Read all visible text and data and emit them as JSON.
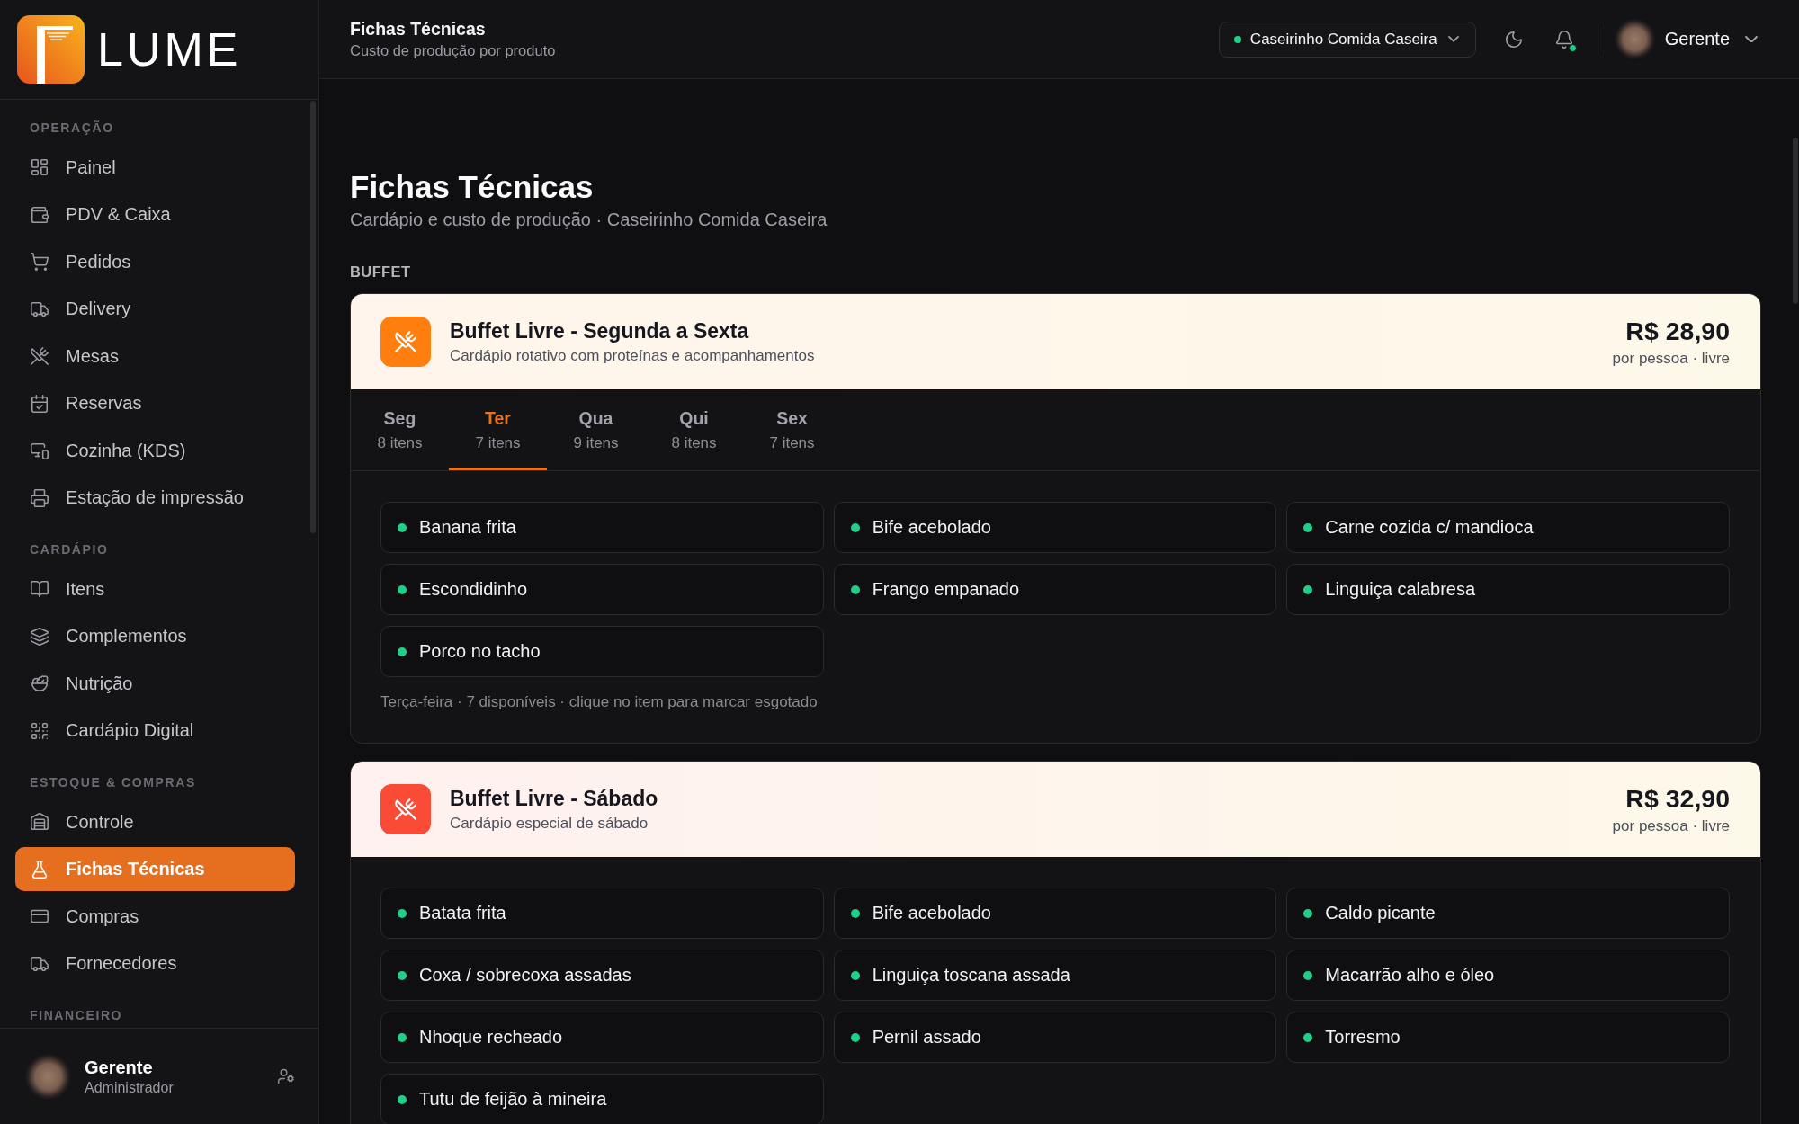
{
  "sidebar": {
    "logo": {
      "wordmark": "LUME"
    },
    "sections": [
      {
        "label": "OPERAÇÃO",
        "items": [
          {
            "label": "Painel",
            "selected": false
          },
          {
            "label": "PDV & Caixa",
            "selected": false
          },
          {
            "label": "Pedidos",
            "selected": false
          },
          {
            "label": "Delivery",
            "selected": false
          },
          {
            "label": "Mesas",
            "selected": false
          },
          {
            "label": "Reservas",
            "selected": false
          },
          {
            "label": "Cozinha (KDS)",
            "selected": false
          },
          {
            "label": "Estação de impressão",
            "selected": false
          }
        ]
      },
      {
        "label": "CARDÁPIO",
        "items": [
          {
            "label": "Itens",
            "selected": false
          },
          {
            "label": "Complementos",
            "selected": false
          },
          {
            "label": "Nutrição",
            "selected": false
          },
          {
            "label": "Cardápio Digital",
            "selected": false
          }
        ]
      },
      {
        "label": "ESTOQUE & COMPRAS",
        "items": [
          {
            "label": "Controle",
            "selected": false
          },
          {
            "label": "Fichas Técnicas",
            "selected": true
          },
          {
            "label": "Compras",
            "selected": false
          },
          {
            "label": "Fornecedores",
            "selected": false
          }
        ]
      },
      {
        "label": "FINANCEIRO"
      }
    ],
    "user": {
      "name": "Gerente",
      "role": "Administrador"
    }
  },
  "header": {
    "title": "Fichas Técnicas",
    "subtitle": "Custo de produção por produto",
    "store": {
      "name": "Caseirinho Comida Caseira",
      "online": true
    },
    "notifications_unread": true,
    "user": {
      "name": "Gerente"
    }
  },
  "page": {
    "title": "Fichas Técnicas",
    "subtitle": "Cardápio e custo de produção · Caseirinho Comida Caseira"
  },
  "groups": [
    {
      "label": "BUFFET",
      "cards": [
        {
          "title": "Buffet Livre - Segunda a Sexta",
          "subtitle": "Cardápio rotativo com proteínas e acompanhamentos",
          "color": "#ff7e0d",
          "price": "R$ 28,90",
          "price_note": "por pessoa · livre",
          "tabs": [
            {
              "day": "Seg",
              "count": "8 itens",
              "selected": false
            },
            {
              "day": "Ter",
              "count": "7 itens",
              "selected": true
            },
            {
              "day": "Qua",
              "count": "9 itens",
              "selected": false
            },
            {
              "day": "Qui",
              "count": "8 itens",
              "selected": false
            },
            {
              "day": "Sex",
              "count": "7 itens",
              "selected": false
            }
          ],
          "items": [
            {
              "name": "Banana frita",
              "available": true
            },
            {
              "name": "Bife acebolado",
              "available": true
            },
            {
              "name": "Carne cozida c/ mandioca",
              "available": true
            },
            {
              "name": "Escondidinho",
              "available": true
            },
            {
              "name": "Frango empanado",
              "available": true
            },
            {
              "name": "Linguiça calabresa",
              "available": true
            },
            {
              "name": "Porco no tacho",
              "available": true
            }
          ],
          "note": "Terça-feira · 7 disponíveis · clique no item para marcar esgotado"
        },
        {
          "title": "Buffet Livre - Sábado",
          "subtitle": "Cardápio especial de sábado",
          "color": "#fa4b37",
          "price": "R$ 32,90",
          "price_note": "por pessoa · livre",
          "items": [
            {
              "name": "Batata frita",
              "available": true
            },
            {
              "name": "Bife acebolado",
              "available": true
            },
            {
              "name": "Caldo picante",
              "available": true
            },
            {
              "name": "Coxa / sobrecoxa assadas",
              "available": true
            },
            {
              "name": "Linguiça toscana assada",
              "available": true
            },
            {
              "name": "Macarrão alho e óleo",
              "available": true
            },
            {
              "name": "Nhoque recheado",
              "available": true
            },
            {
              "name": "Pernil assado",
              "available": true
            },
            {
              "name": "Torresmo",
              "available": true
            },
            {
              "name": "Tutu de feijão à mineira",
              "available": true
            }
          ]
        }
      ]
    }
  ]
}
